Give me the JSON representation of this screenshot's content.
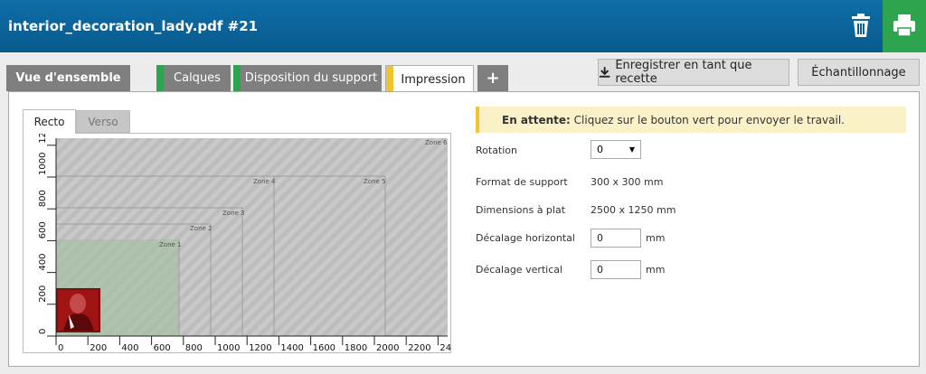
{
  "window": {
    "title": "interior_decoration_lady.pdf #21"
  },
  "tabs": [
    {
      "label": "Vue d'ensemble"
    },
    {
      "label": "Calques"
    },
    {
      "label": "Disposition du support"
    },
    {
      "label": "Impression"
    },
    {
      "label": "+"
    }
  ],
  "buttons": {
    "save_recipe": "Enregistrer en tant que recette",
    "sampling": "Échantillonnage"
  },
  "subtabs": {
    "front": "Recto",
    "back": "Verso"
  },
  "notice": {
    "bold": "En attente:",
    "text": " Cliquez sur le bouton vert pour envoyer le travail."
  },
  "settings": {
    "rotation_label": "Rotation",
    "rotation_value": "0",
    "media_format_label": "Format de support",
    "media_format_value": "300 x 300 mm",
    "flat_dimensions_label": "Dimensions à plat",
    "flat_dimensions_value": "2500 x 1250 mm",
    "h_offset_label": "Décalage horizontal",
    "h_offset_value": "0",
    "h_offset_unit": "mm",
    "v_offset_label": "Décalage vertical",
    "v_offset_value": "0",
    "v_offset_unit": "mm"
  },
  "preview": {
    "zones": [
      "Zone 1",
      "Zone 2",
      "Zone 3",
      "Zone 4",
      "Zone 5",
      "Zone 6"
    ],
    "x_ticks": [
      "0",
      "200",
      "400",
      "600",
      "800",
      "1000",
      "1200",
      "1400",
      "1600",
      "1800",
      "2000",
      "2200",
      "24"
    ],
    "y_ticks": [
      "0",
      "200",
      "400",
      "600",
      "800",
      "1000",
      "1200"
    ]
  },
  "colors": {
    "accent_green": "#2ea44f",
    "accent_yellow": "#f1c232",
    "header_blue": "#0a629a"
  },
  "icons": {
    "delete": "trash-icon",
    "print": "printer-icon",
    "save": "download-icon",
    "select": "caret-down-icon"
  }
}
